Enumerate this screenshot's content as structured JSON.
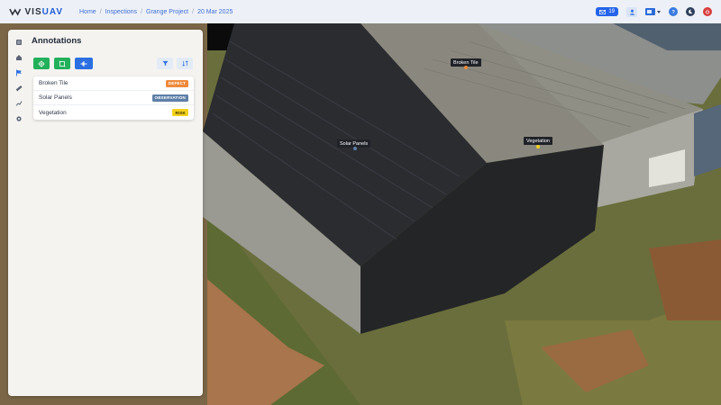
{
  "app": {
    "brand_prefix": "VIS",
    "brand_suffix": "UAV"
  },
  "breadcrumb": [
    "Home",
    "Inspections",
    "Grange Project",
    "20 Mar 2025"
  ],
  "toolbar": {
    "messages_count": "19"
  },
  "panel": {
    "title": "Annotations",
    "annotations": [
      {
        "name": "Broken Tile",
        "tag": "DEFECT",
        "tag_color": "#ef8a3b"
      },
      {
        "name": "Solar Panels",
        "tag": "OBSERVATION",
        "tag_color": "#5d7fa8"
      },
      {
        "name": "Vegetation",
        "tag": "RISK",
        "tag_color": "#f3d21c"
      }
    ]
  },
  "scene": {
    "labels": [
      {
        "text": "Broken Tile",
        "pin_color": "#ef8a3b"
      },
      {
        "text": "Solar Panels",
        "pin_color": "#5d7fa8"
      },
      {
        "text": "Vegetation",
        "pin_color": "#f3d21c"
      }
    ]
  }
}
